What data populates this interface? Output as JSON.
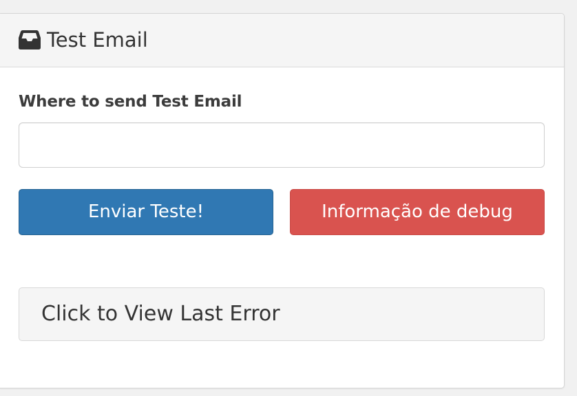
{
  "panel": {
    "title": "Test Email",
    "icon": "inbox-icon"
  },
  "form": {
    "label": "Where to send Test Email",
    "email_value": "",
    "email_placeholder": ""
  },
  "buttons": {
    "send_label": "Enviar Teste!",
    "debug_label": "Informação de debug"
  },
  "error": {
    "link_label": "Click to View Last Error"
  },
  "colors": {
    "primary": "#3078b3",
    "danger": "#d9534f",
    "panel_heading": "#f5f5f5"
  }
}
